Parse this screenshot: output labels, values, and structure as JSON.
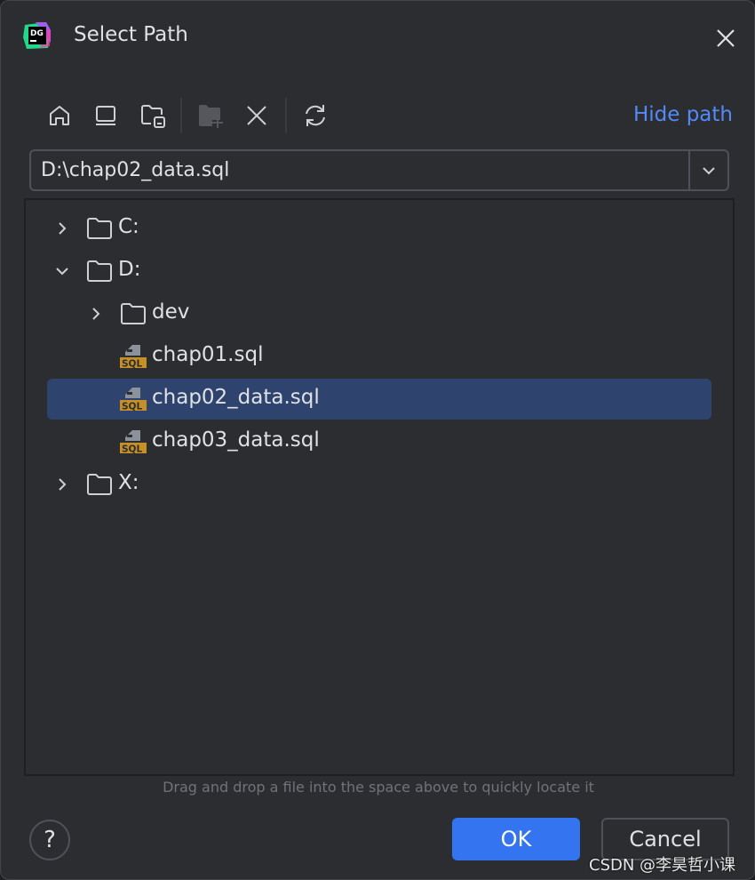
{
  "window": {
    "title": "Select Path",
    "logo_text": "DG"
  },
  "toolbar": {
    "icons": [
      "home-icon",
      "desktop-icon",
      "project-folder-icon",
      "new-folder-icon",
      "delete-icon",
      "refresh-icon"
    ],
    "hide_path_label": "Hide path"
  },
  "path_field": {
    "value": "D:\\chap02_data.sql"
  },
  "tree": {
    "items": [
      {
        "label": "C:",
        "type": "folder",
        "level": 0,
        "expanded": false
      },
      {
        "label": "D:",
        "type": "folder",
        "level": 0,
        "expanded": true
      },
      {
        "label": "dev",
        "type": "folder",
        "level": 1,
        "expanded": false
      },
      {
        "label": "chap01.sql",
        "type": "sql",
        "level": 1
      },
      {
        "label": "chap02_data.sql",
        "type": "sql",
        "level": 1,
        "selected": true
      },
      {
        "label": "chap03_data.sql",
        "type": "sql",
        "level": 1
      },
      {
        "label": "X:",
        "type": "folder",
        "level": 0,
        "expanded": false
      }
    ],
    "sql_badge": "SQL"
  },
  "hint": "Drag and drop a file into the space above to quickly locate it",
  "buttons": {
    "help": "?",
    "ok": "OK",
    "cancel": "Cancel"
  },
  "watermark": "CSDN @李昊哲小课",
  "colors": {
    "accent": "#3574f0",
    "link": "#548af7",
    "selection": "#2e436e",
    "sql_icon": "#c69026"
  }
}
